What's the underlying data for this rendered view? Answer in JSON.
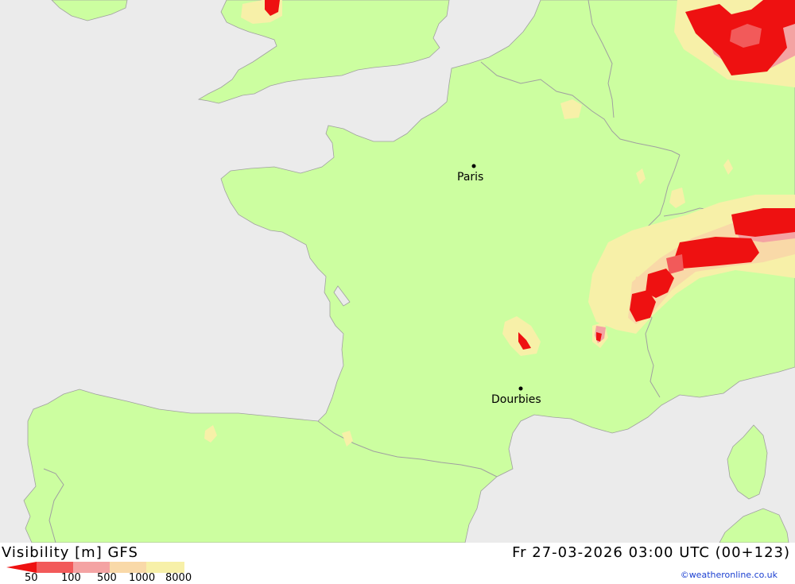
{
  "map": {
    "cities": [
      {
        "name": "Paris"
      },
      {
        "name": "Dourbies"
      }
    ]
  },
  "footer": {
    "title": "Visibility [m] GFS",
    "run": "Fr 27-03-2026 03:00 UTC (00+123)",
    "credit": "©weatheronline.co.uk"
  },
  "legend": {
    "ticks": [
      "50",
      "100",
      "500",
      "1000",
      "8000"
    ],
    "colors": [
      "#ee1111",
      "#f25a5a",
      "#f4a3a3",
      "#f9d9a8",
      "#f7f0a8"
    ]
  },
  "colors": {
    "sea": "#ebebeb",
    "land": "#ccfea0",
    "border": "#a0a0a0"
  }
}
